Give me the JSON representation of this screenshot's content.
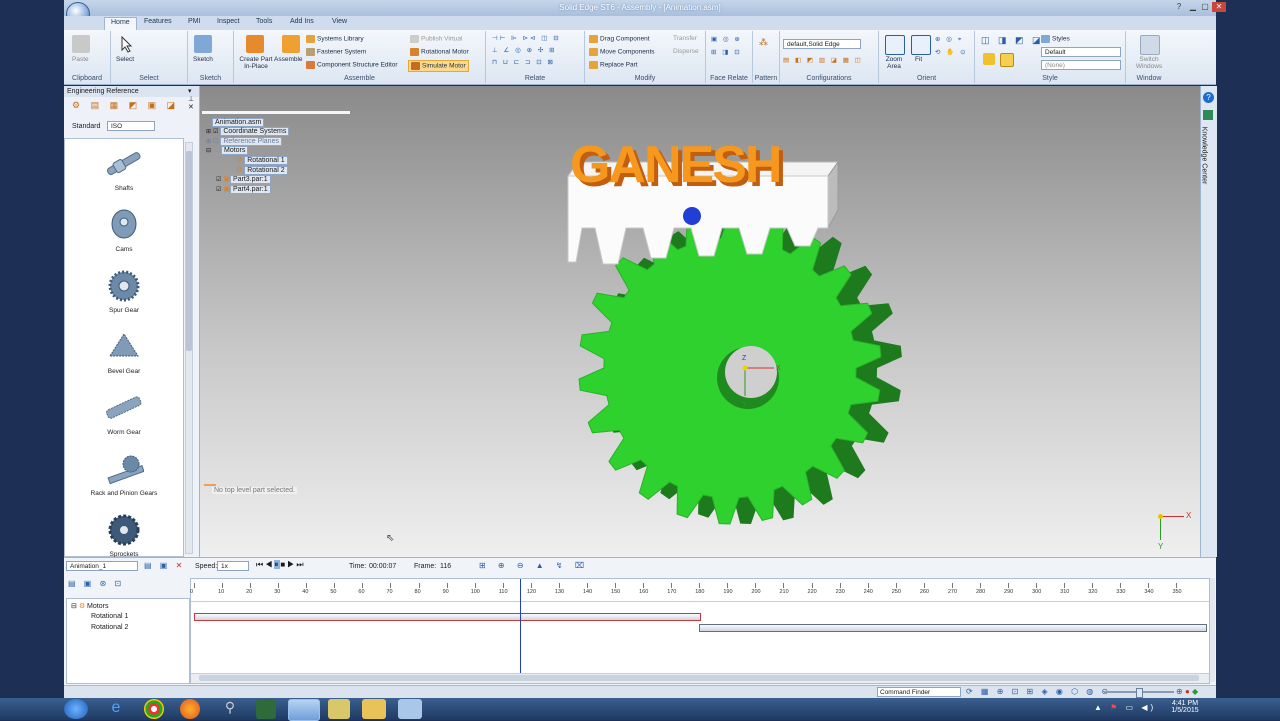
{
  "window": {
    "title": "Solid Edge ST6 - Assembly - [Animation.asm]"
  },
  "ribbon_tabs": [
    {
      "label": "Home",
      "active": true
    },
    {
      "label": "Features"
    },
    {
      "label": "PMI"
    },
    {
      "label": "Inspect"
    },
    {
      "label": "Tools"
    },
    {
      "label": "Add Ins"
    },
    {
      "label": "View"
    }
  ],
  "ribbon": {
    "groups": [
      "Clipboard",
      "Select",
      "Sketch",
      "Assemble",
      "Relate",
      "Modify",
      "Face Relate",
      "Pattern",
      "Configurations",
      "Orient",
      "Style",
      "Window"
    ],
    "paste": "Paste",
    "select": "Select",
    "sketch": "Sketch",
    "create_part": "Create Part In-Place",
    "assemble": "Assemble",
    "systems_library": "Systems Library",
    "fastener_system": "Fastener System",
    "component_structure_editor": "Component Structure Editor",
    "publish_virtual": "Publish Virtual",
    "rotational_motor": "Rotational Motor",
    "simulate_motor": "Simulate Motor",
    "drag_component": "Drag Component",
    "move_components": "Move Components",
    "replace_part": "Replace Part",
    "transfer": "Transfer",
    "disperse": "Disperse",
    "config_value": "default,Solid Edge",
    "zoom_area": "Zoom Area",
    "fit": "Fit",
    "styles": "Styles",
    "style_value": "Default",
    "style_none": "(None)",
    "switch_windows": "Switch Windows"
  },
  "engineering_reference": {
    "title": "Engineering Reference",
    "standard_label": "Standard",
    "standard_value": "ISO",
    "items": [
      "Shafts",
      "Cams",
      "Spur Gear",
      "Bevel Gear",
      "Worm Gear",
      "Rack and Pinion Gears",
      "Sprockets"
    ]
  },
  "tree": {
    "root": "Animation.asm",
    "items": [
      {
        "label": "Coordinate Systems",
        "checked": true
      },
      {
        "label": "Reference Planes",
        "checked": false
      },
      {
        "label": "Motors",
        "checked": false
      },
      {
        "label": "Rotational 1",
        "checked": false
      },
      {
        "label": "Rotational 2",
        "checked": false
      },
      {
        "label": "Part3.par:1",
        "checked": true
      },
      {
        "label": "Part4.par:1",
        "checked": true
      }
    ]
  },
  "viewport": {
    "model_text": "GANESH",
    "status_message": "No top level part selected.",
    "axis_x": "X",
    "axis_y": "Y",
    "axis_z": "Z"
  },
  "right_strip": {
    "label": "Knowledge Center"
  },
  "timeline": {
    "animation_name": "Animation_1",
    "speed_label": "Speed:",
    "speed_value": "1x",
    "time_label": "Time:",
    "time_value": "00:00:07",
    "frame_label": "Frame:",
    "frame_value": "116",
    "ruler": [
      "0",
      "10",
      "20",
      "30",
      "40",
      "50",
      "60",
      "70",
      "80",
      "90",
      "100",
      "110",
      "120",
      "130",
      "140",
      "150",
      "160",
      "170",
      "180",
      "190",
      "200",
      "210",
      "220",
      "230",
      "240",
      "250",
      "260",
      "270",
      "280",
      "290",
      "300",
      "310",
      "320",
      "330",
      "340",
      "350"
    ],
    "tracks": {
      "motors": "Motors",
      "rot1": "Rotational 1",
      "rot2": "Rotational 2"
    },
    "segments": [
      {
        "track": "Rotational 1",
        "start": 0,
        "end": 180
      },
      {
        "track": "Rotational 2",
        "start": 180,
        "end": 360
      }
    ],
    "current_frame": 116
  },
  "status_bar": {
    "command_finder": "Command Finder"
  },
  "clock": {
    "time": "4:41 PM",
    "date": "1/5/2015"
  }
}
